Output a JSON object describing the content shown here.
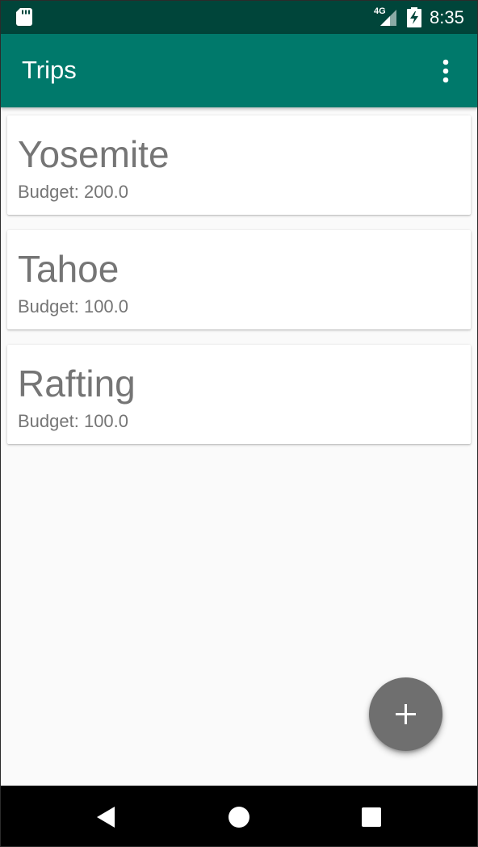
{
  "status_bar": {
    "network_label": "4G",
    "time": "8:35",
    "icons": [
      "sd-card-icon",
      "cellular-signal-icon",
      "battery-charging-icon"
    ]
  },
  "app_bar": {
    "title": "Trips",
    "menu_icon": "more-vert-icon"
  },
  "trips": [
    {
      "name": "Yosemite",
      "budget": "Budget: 200.0"
    },
    {
      "name": "Tahoe",
      "budget": "Budget: 100.0"
    },
    {
      "name": "Rafting",
      "budget": "Budget: 100.0"
    }
  ],
  "fab": {
    "icon": "plus-icon"
  },
  "nav_bar": {
    "icons": [
      "back-icon",
      "home-icon",
      "recents-icon"
    ]
  },
  "colors": {
    "status_bar": "#00453a",
    "app_bar": "#00796b",
    "background": "#fafafa",
    "card": "#ffffff",
    "text_secondary": "#757575",
    "fab": "#6f6f6f",
    "nav_bar": "#000000"
  }
}
